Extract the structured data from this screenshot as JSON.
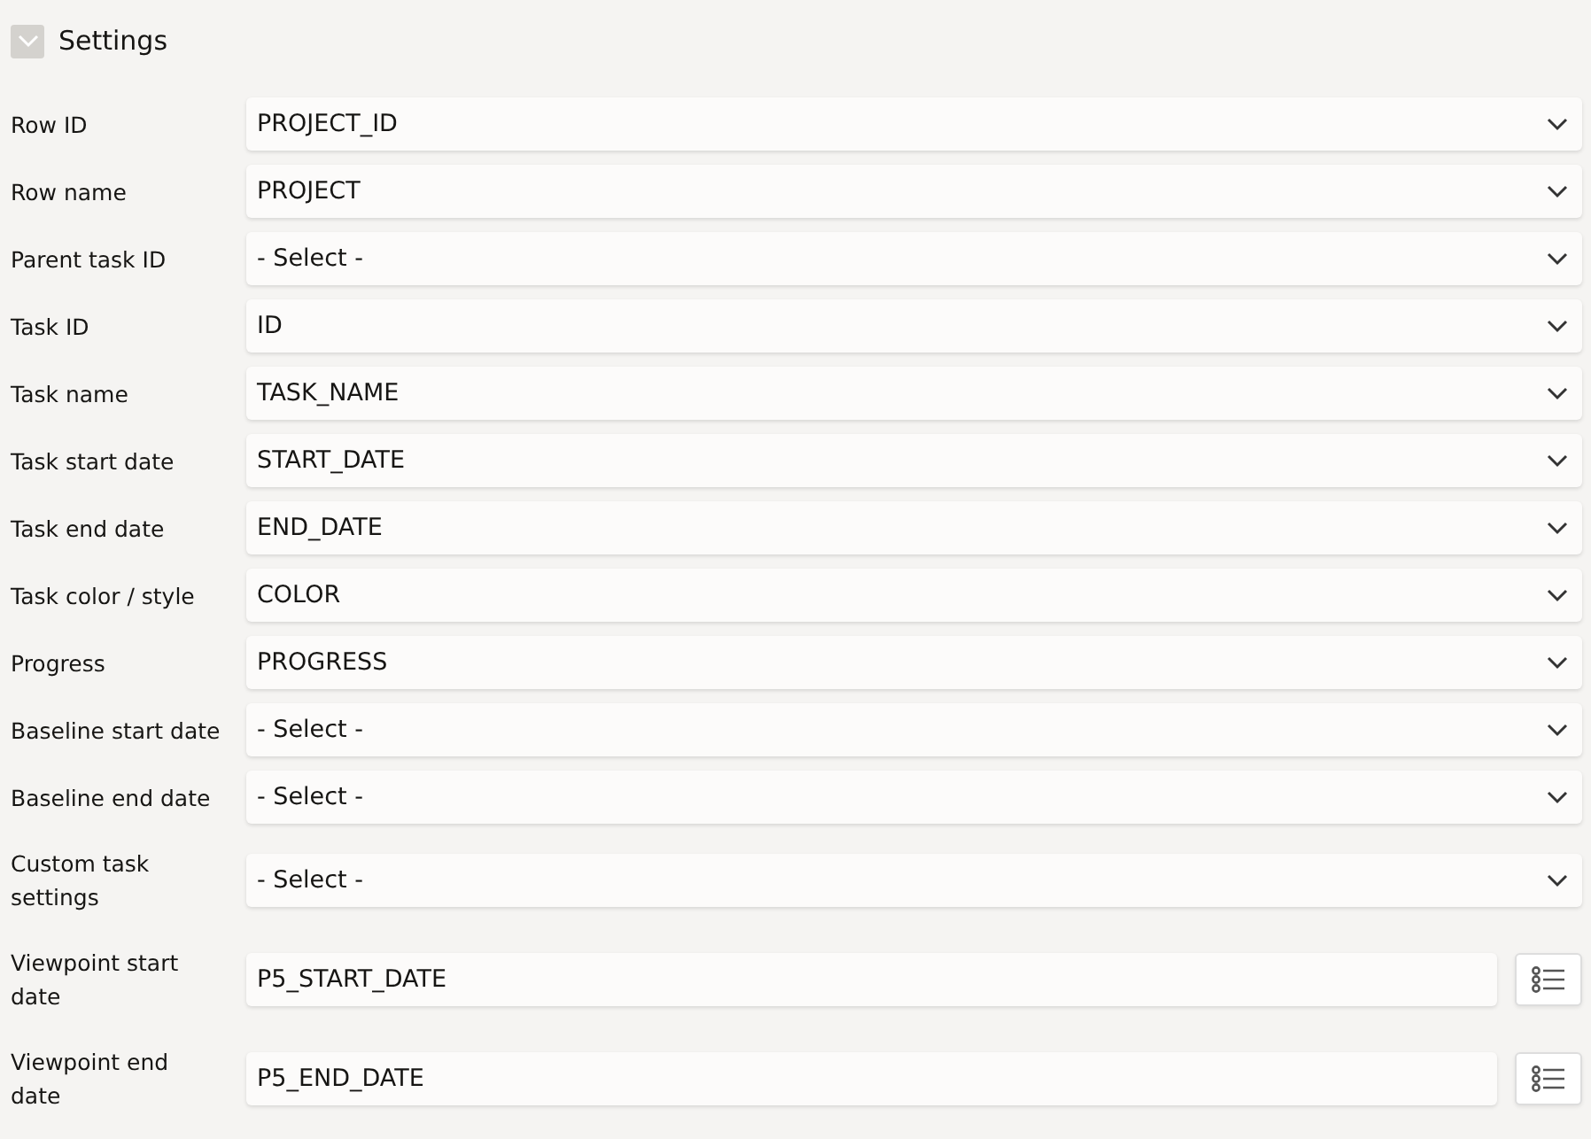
{
  "section": {
    "title": "Settings",
    "expanded": true
  },
  "fields": [
    {
      "label": "Row ID",
      "value": "PROJECT_ID",
      "kind": "select"
    },
    {
      "label": "Row name",
      "value": "PROJECT",
      "kind": "select"
    },
    {
      "label": "Parent task ID",
      "value": "- Select -",
      "kind": "select"
    },
    {
      "label": "Task ID",
      "value": "ID",
      "kind": "select"
    },
    {
      "label": "Task name",
      "value": "TASK_NAME",
      "kind": "select"
    },
    {
      "label": "Task start date",
      "value": "START_DATE",
      "kind": "select"
    },
    {
      "label": "Task end date",
      "value": "END_DATE",
      "kind": "select"
    },
    {
      "label": "Task color / style",
      "value": "COLOR",
      "kind": "select"
    },
    {
      "label": "Progress",
      "value": "PROGRESS",
      "kind": "select"
    },
    {
      "label": "Baseline start date",
      "value": "- Select -",
      "kind": "select"
    },
    {
      "label": "Baseline end date",
      "value": "- Select -",
      "kind": "select"
    },
    {
      "label": "Custom task settings",
      "value": "- Select -",
      "kind": "select"
    },
    {
      "label": "Viewpoint start date",
      "value": "P5_START_DATE",
      "kind": "lov"
    },
    {
      "label": "Viewpoint end date",
      "value": "P5_END_DATE",
      "kind": "lov"
    }
  ]
}
